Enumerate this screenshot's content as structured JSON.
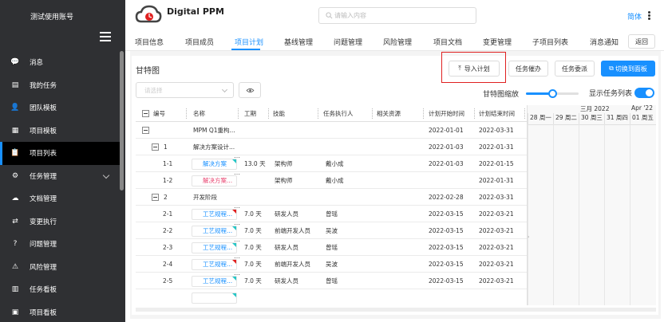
{
  "sidebar": {
    "account": "测试使用账号",
    "items": [
      {
        "label": "消息",
        "icon": "chat-icon",
        "active": false,
        "expandable": false
      },
      {
        "label": "我的任务",
        "icon": "document-icon",
        "active": false,
        "expandable": false
      },
      {
        "label": "团队模板",
        "icon": "users-icon",
        "active": false,
        "expandable": false
      },
      {
        "label": "项目模板",
        "icon": "template-icon",
        "active": false,
        "expandable": false
      },
      {
        "label": "项目列表",
        "icon": "clipboard-icon",
        "active": true,
        "expandable": false
      },
      {
        "label": "任务管理",
        "icon": "task-icon",
        "active": false,
        "expandable": true
      },
      {
        "label": "文档管理",
        "icon": "cloud-upload-icon",
        "active": false,
        "expandable": false
      },
      {
        "label": "变更执行",
        "icon": "change-icon",
        "active": false,
        "expandable": false
      },
      {
        "label": "问题管理",
        "icon": "question-icon",
        "active": false,
        "expandable": false
      },
      {
        "label": "风险管理",
        "icon": "risk-icon",
        "active": false,
        "expandable": false
      },
      {
        "label": "任务看板",
        "icon": "kanban-icon",
        "active": false,
        "expandable": false
      },
      {
        "label": "项目看板",
        "icon": "project-board-icon",
        "active": false,
        "expandable": false
      }
    ]
  },
  "header": {
    "app_title": "Digital PPM",
    "search_placeholder": "请输入内容",
    "language": "简体"
  },
  "tabs": {
    "items": [
      "项目信息",
      "项目成员",
      "项目计划",
      "基线管理",
      "问题管理",
      "风险管理",
      "项目文档",
      "变更管理",
      "子项目列表",
      "消息通知"
    ],
    "active": "项目计划",
    "back_label": "返回"
  },
  "toolbar": {
    "title": "甘特图",
    "import_label": "导入计划",
    "urge_label": "任务催办",
    "assign_label": "任务委派",
    "switch_label": "切换到面板",
    "select_placeholder": "请选择",
    "zoom_label": "甘特图缩放",
    "zoom_level": 0.5,
    "show_task_list_label": "显示任务列表",
    "show_task_list": true
  },
  "grid": {
    "columns": [
      "编号",
      "名称",
      "工期",
      "技能",
      "任务执行人",
      "相关资源",
      "计划开始时间",
      "计划结束时间"
    ],
    "rows": [
      {
        "level": 0,
        "toggle": "−",
        "id": "",
        "name": "MPM Q1重构...",
        "style": "plain",
        "duration": "",
        "skill": "",
        "assignee": "",
        "resource": "",
        "start": "2022-01-01",
        "end": "2022-03-31",
        "marker": "",
        "dots": false
      },
      {
        "level": 1,
        "toggle": "−",
        "id": "1",
        "name": "解决方案设计...",
        "style": "plain",
        "duration": "",
        "skill": "",
        "assignee": "",
        "resource": "",
        "start": "2022-01-03",
        "end": "2022-01-31",
        "marker": "",
        "dots": false
      },
      {
        "level": 2,
        "toggle": "",
        "id": "1-1",
        "name": "解决方案",
        "style": "link",
        "duration": "13.0 天",
        "skill": "架构师",
        "assignee": "戴小成",
        "resource": "",
        "start": "2022-01-03",
        "end": "2022-01-15",
        "marker": "teal",
        "dots": true
      },
      {
        "level": 2,
        "toggle": "",
        "id": "1-2",
        "name": "解决方案...",
        "style": "red",
        "duration": "",
        "skill": "架构师",
        "assignee": "戴小成",
        "resource": "",
        "start": "",
        "end": "2022-01-31",
        "marker": "",
        "dots": true
      },
      {
        "level": 1,
        "toggle": "−",
        "id": "2",
        "name": "开发阶段",
        "style": "plain",
        "duration": "",
        "skill": "",
        "assignee": "",
        "resource": "",
        "start": "2022-02-28",
        "end": "2022-03-31",
        "marker": "",
        "dots": false
      },
      {
        "level": 2,
        "toggle": "",
        "id": "2-1",
        "name": "工艺规程...",
        "style": "link",
        "duration": "7.0 天",
        "skill": "研发人员",
        "assignee": "曾瑶",
        "resource": "",
        "start": "2022-03-15",
        "end": "2022-03-21",
        "marker": "red",
        "dots": true
      },
      {
        "level": 2,
        "toggle": "",
        "id": "2-2",
        "name": "工艺规程...",
        "style": "link",
        "duration": "7.0 天",
        "skill": "前端开发人员",
        "assignee": "吴波",
        "resource": "",
        "start": "2022-03-15",
        "end": "2022-03-21",
        "marker": "teal",
        "dots": true
      },
      {
        "level": 2,
        "toggle": "",
        "id": "2-3",
        "name": "工艺规程...",
        "style": "link",
        "duration": "7.0 天",
        "skill": "研发人员",
        "assignee": "曾瑶",
        "resource": "",
        "start": "2022-03-15",
        "end": "2022-03-21",
        "marker": "teal",
        "dots": true
      },
      {
        "level": 2,
        "toggle": "",
        "id": "2-4",
        "name": "工艺规程...",
        "style": "link",
        "duration": "7.0 天",
        "skill": "前端开发人员",
        "assignee": "吴波",
        "resource": "",
        "start": "2022-03-15",
        "end": "2022-03-21",
        "marker": "red",
        "dots": true
      },
      {
        "level": 2,
        "toggle": "",
        "id": "2-5",
        "name": "工艺规程...",
        "style": "link",
        "duration": "7.0 天",
        "skill": "研发人员",
        "assignee": "曾瑶",
        "resource": "",
        "start": "2022-03-15",
        "end": "2022-03-21",
        "marker": "teal",
        "dots": true
      },
      {
        "level": 2,
        "toggle": "",
        "id": "",
        "name": "",
        "style": "link",
        "duration": "",
        "skill": "",
        "assignee": "",
        "resource": "",
        "start": "",
        "end": "",
        "marker": "teal",
        "dots": false
      }
    ]
  },
  "timeline": {
    "months": [
      "三月 2022",
      "Apr '22"
    ],
    "days": [
      "28 周一",
      "29 周二",
      "30 周三",
      "31 周四",
      "01 周五"
    ],
    "today_marker": "›"
  },
  "colors": {
    "sidebar_bg": "#2f3033",
    "accent": "#1890ff",
    "highlight": "#e02020",
    "link": "#1890ff",
    "danger": "#e8436f"
  }
}
